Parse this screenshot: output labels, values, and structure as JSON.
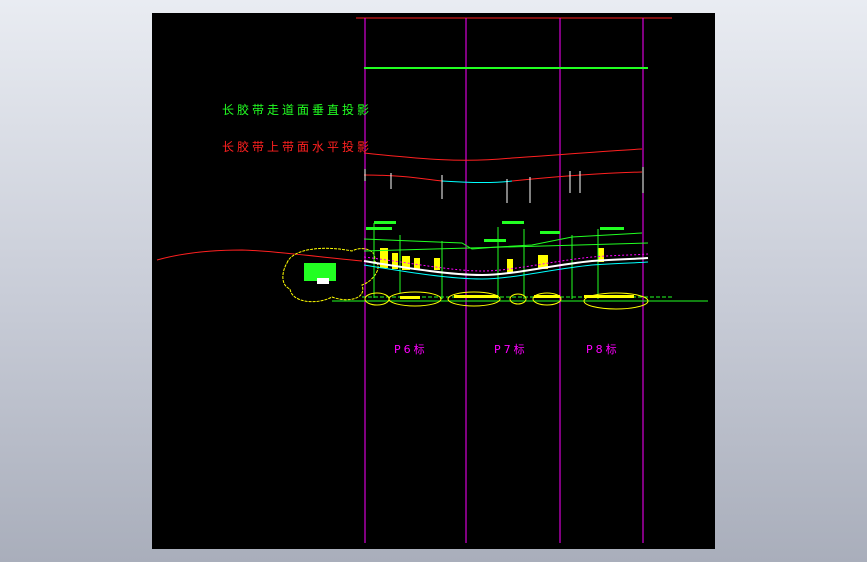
{
  "drawing": {
    "legend": [
      {
        "text": "长胶带走道面垂直投影",
        "color": "#22ff22"
      },
      {
        "text": "长胶带上带面水平投影",
        "color": "#ff2020"
      }
    ],
    "sections": [
      {
        "label": "P6标"
      },
      {
        "label": "P7标"
      },
      {
        "label": "P8标"
      }
    ],
    "colors": {
      "background": "#000000",
      "grid_line": "#ff00ff",
      "projection_red": "#ff2020",
      "walkway_green": "#22ff22",
      "equipment_yellow": "#ffff00",
      "belt_cyan": "#00ffff",
      "section_label": "#ff00ff"
    }
  }
}
